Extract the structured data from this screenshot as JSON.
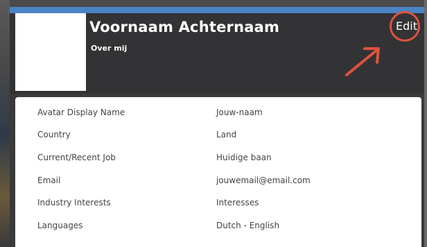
{
  "profile": {
    "name": "Voornaam Achternaam",
    "about": "Over mij",
    "edit_label": "Edit"
  },
  "details": [
    {
      "label": "Avatar Display Name",
      "value": "Jouw-naam"
    },
    {
      "label": "Country",
      "value": "Land"
    },
    {
      "label": "Current/Recent Job",
      "value": "Huidige baan"
    },
    {
      "label": "Email",
      "value": "jouwemail@email.com"
    },
    {
      "label": "Industry Interests",
      "value": "Interesses"
    },
    {
      "label": "Languages",
      "value": "Dutch - English"
    }
  ],
  "colors": {
    "accent_bar": "#4a84c4",
    "header_bg": "#333335",
    "annotation": "#e0533d"
  }
}
